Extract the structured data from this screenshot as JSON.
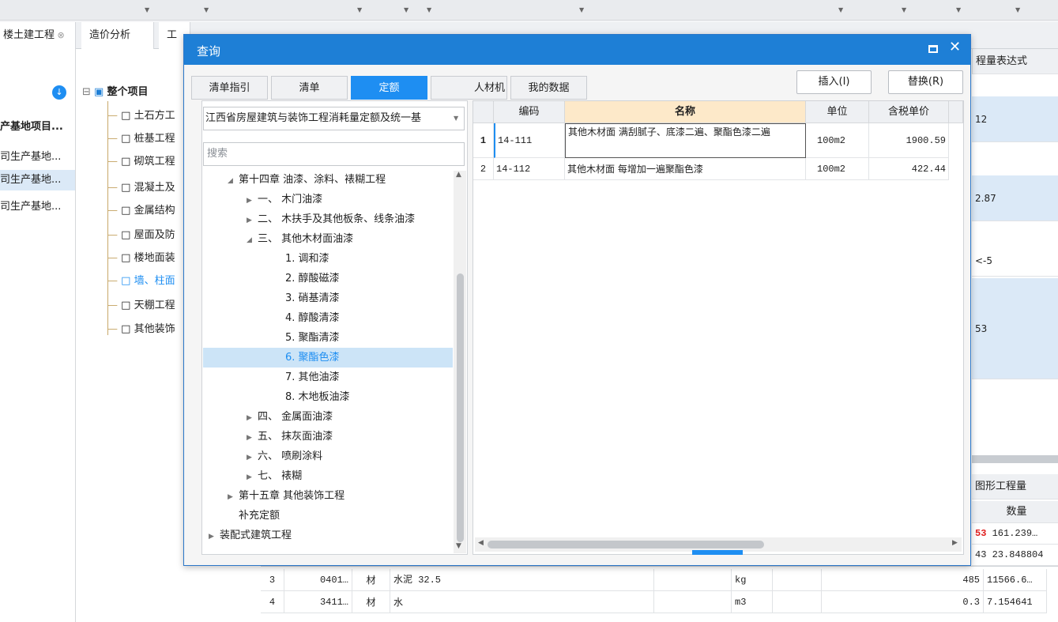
{
  "background": {
    "tabs": [
      "楼土建工程",
      "造价分析",
      "工"
    ],
    "left_items": [
      "产基地项目...",
      "司生产基地...",
      "司生产基地...",
      "司生产基地..."
    ],
    "tree_root": "整个项目",
    "tree_children": [
      "土石方工",
      "桩基工程",
      "砌筑工程",
      "混凝土及",
      "金属结构",
      "屋面及防",
      "楼地面装",
      "墙、柱面",
      "天棚工程",
      "其他装饰"
    ],
    "right_header": "程量表达式",
    "right_values": [
      "12",
      "2.87",
      "<-5",
      "53"
    ],
    "right_tab2": "图形工程量",
    "qty_header": "数量",
    "qty_rows": [
      {
        "a": "53",
        "b": "161.239…"
      },
      {
        "a": "43",
        "b": "23.848804"
      }
    ],
    "bottom_rows": [
      {
        "num": "3",
        "code": "0401…",
        "kind": "材",
        "name": "水泥 32.5",
        "unit": "kg",
        "a": "485",
        "b": "11566.6…"
      },
      {
        "num": "4",
        "code": "3411…",
        "kind": "材",
        "name": "水",
        "unit": "m3",
        "a": "0.3",
        "b": "7.154641"
      }
    ]
  },
  "dialog": {
    "title": "查询",
    "tabs": [
      "清单指引",
      "清单",
      "定额",
      "人材机",
      "我的数据"
    ],
    "insert_button": "插入(I)",
    "replace_button": "替换(R)",
    "quota_select": "江西省房屋建筑与装饰工程消耗量定额及统一基",
    "search_placeholder": "搜索",
    "chapter_tree": [
      "第十四章 油漆、涂料、裱糊工程",
      "一、 木门油漆",
      "二、 木扶手及其他板条、线条油漆",
      "三、 其他木材面油漆",
      "1. 调和漆",
      "2. 醇酸磁漆",
      "3. 硝基清漆",
      "4. 醇酸清漆",
      "5. 聚酯清漆",
      "6. 聚酯色漆",
      "7. 其他油漆",
      "8. 木地板油漆",
      "四、 金属面油漆",
      "五、 抹灰面油漆",
      "六、 喷刷涂料",
      "七、 裱糊",
      "第十五章 其他装饰工程",
      "补充定额",
      "装配式建筑工程"
    ],
    "grid_headers": [
      "编码",
      "名称",
      "单位",
      "含税单价"
    ],
    "grid_rows": [
      {
        "num": "1",
        "code": "14-111",
        "name": "其他木材面 满刮腻子、底漆二遍、聚酯色漆二遍",
        "unit": "100m2",
        "price": "1900.59"
      },
      {
        "num": "2",
        "code": "14-112",
        "name": "其他木材面 每增加一遍聚酯色漆",
        "unit": "100m2",
        "price": "422.44"
      }
    ]
  },
  "colors": {
    "title_bar": "#1e7fd6",
    "active_tab": "#1e8ef2",
    "name_header": "#fde9c9",
    "selected_node": "#cce4f7"
  }
}
